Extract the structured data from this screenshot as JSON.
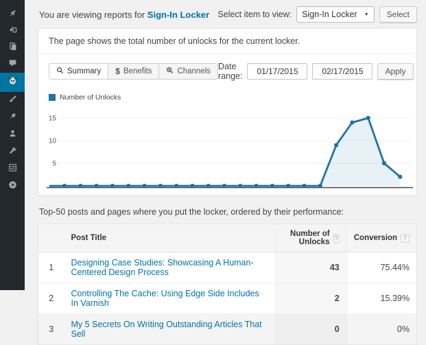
{
  "app": {
    "accent_color": "#0074a2",
    "sidebar_color": "#23282d"
  },
  "sidebar": {
    "items": [
      {
        "name": "posts",
        "icon": "pushpin-icon"
      },
      {
        "name": "media",
        "icon": "media-icon"
      },
      {
        "name": "pages",
        "icon": "pages-icon"
      },
      {
        "name": "comments",
        "icon": "comment-icon"
      },
      {
        "name": "optin-panda",
        "icon": "panda-icon",
        "active": true
      },
      {
        "name": "appearance",
        "icon": "paintbrush-icon"
      },
      {
        "name": "plugins",
        "icon": "plug-icon"
      },
      {
        "name": "users",
        "icon": "user-icon"
      },
      {
        "name": "tools",
        "icon": "wrench-icon"
      },
      {
        "name": "settings",
        "icon": "sliders-icon"
      },
      {
        "name": "video",
        "icon": "play-circle-icon"
      }
    ]
  },
  "topbar": {
    "viewing_prefix": "You are viewing reports for",
    "viewing_link": "Sign-In Locker",
    "select_label": "Select item to view:",
    "select_value": "Sign-In Locker",
    "select_button": "Select"
  },
  "panel": {
    "description": "The page shows the total number of unlocks for the current locker.",
    "tabs": [
      {
        "label": "Summary",
        "icon": "search-icon",
        "active": true
      },
      {
        "label": "Benefits",
        "icon": "dollar-icon",
        "active": false
      },
      {
        "label": "Channels",
        "icon": "search-plus-icon",
        "active": false
      }
    ],
    "date_range": {
      "label": "Date range:",
      "start": "01/17/2015",
      "end": "02/17/2015",
      "apply_label": "Apply"
    }
  },
  "chart_data": {
    "type": "line",
    "title": "",
    "legend_label": "Number of Unlocks",
    "color": "#1d74a6",
    "fill": "rgba(29,116,166,0.10)",
    "grid": true,
    "legend_position": "top-left",
    "x_labels_shown": false,
    "values": [
      0,
      0,
      0,
      0,
      0,
      0,
      0,
      0,
      0,
      0,
      0,
      0,
      0,
      0,
      0,
      0,
      0,
      9,
      14,
      15,
      5,
      2
    ],
    "yticks": [
      5,
      10,
      15
    ],
    "ylim": [
      0,
      17
    ],
    "xlabel": "",
    "ylabel": ""
  },
  "table_section": {
    "intro": "Top-50 posts and pages where you put the locker, ordered by their performance:",
    "columns": {
      "title": "Post Title",
      "unlocks": "Number of Unlocks",
      "conversion": "Conversion"
    },
    "help_glyph": "?",
    "rows": [
      {
        "rank": "1",
        "title": "Designing Case Studies: Showcasing A Human-Centered Design Process",
        "unlocks": "43",
        "conversion": "75.44%"
      },
      {
        "rank": "2",
        "title": "Controlling The Cache: Using Edge Side Includes In Varnish",
        "unlocks": "2",
        "conversion": "15.39%"
      },
      {
        "rank": "3",
        "title": "My 5 Secrets On Writing Outstanding Articles That Sell",
        "unlocks": "0",
        "conversion": "0%"
      }
    ]
  }
}
